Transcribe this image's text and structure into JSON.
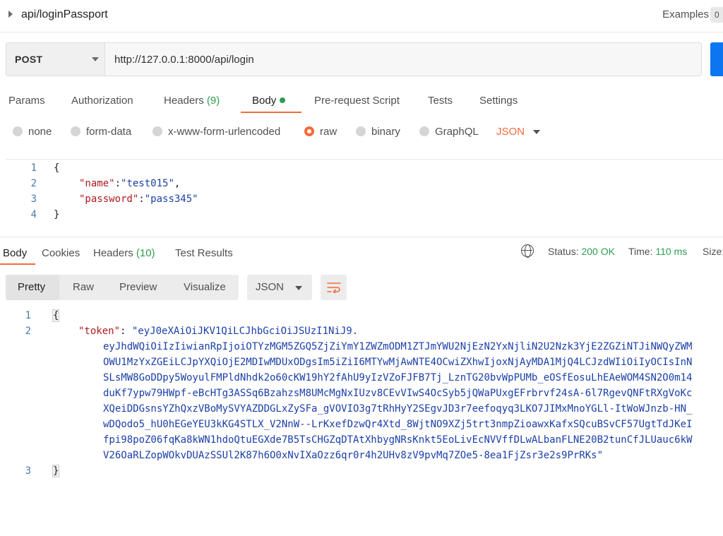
{
  "header": {
    "title": "api/loginPassport",
    "examples_label": "Examples",
    "examples_count": "0"
  },
  "request": {
    "method": "POST",
    "url": "http://127.0.0.1:8000/api/login",
    "tabs": [
      {
        "label": "Params"
      },
      {
        "label": "Authorization"
      },
      {
        "label": "Headers",
        "count": "(9)"
      },
      {
        "label": "Body"
      },
      {
        "label": "Pre-request Script"
      },
      {
        "label": "Tests"
      },
      {
        "label": "Settings"
      }
    ],
    "active_tab": "Body",
    "body_types": [
      "none",
      "form-data",
      "x-www-form-urlencoded",
      "raw",
      "binary",
      "GraphQL"
    ],
    "selected_body_type": "raw",
    "format": "JSON",
    "body_lines": [
      {
        "n": "1",
        "open": "{"
      },
      {
        "n": "2",
        "key": "\"name\"",
        "sep": ":",
        "val": "\"test015\"",
        "tail": ","
      },
      {
        "n": "3",
        "key": "\"password\"",
        "sep": ":",
        "val": "\"pass345\"",
        "tail": ""
      },
      {
        "n": "4",
        "close": "}"
      }
    ]
  },
  "response": {
    "tabs": [
      {
        "label": "Body"
      },
      {
        "label": "Cookies"
      },
      {
        "label": "Headers",
        "count": "(10)"
      },
      {
        "label": "Test Results"
      }
    ],
    "status_label": "Status:",
    "status_value": "200 OK",
    "time_label": "Time:",
    "time_value": "110 ms",
    "size_label": "Size:",
    "views": [
      "Pretty",
      "Raw",
      "Preview",
      "Visualize"
    ],
    "active_view": "Pretty",
    "format": "JSON",
    "line_numbers": [
      "1",
      "2",
      "3"
    ],
    "open_brace": "{",
    "close_brace": "}",
    "token_key": "\"token\"",
    "token_sep": ": ",
    "token_lines": [
      "\"eyJ0eXAiOiJKV1QiLCJhbGciOiJSUzI1NiJ9.",
      "eyJhdWQiOiIzIiwianRpIjoiOTYzMGM5ZGQ5ZjZiYmY1ZWZmODM1ZTJmYWU2NjEzN2YxNjliN2U2Nzk3YjE2ZGZiNTJiNWQyZWM",
      "OWU1MzYxZGEiLCJpYXQiOjE2MDIwMDUxODgsIm5iZiI6MTYwMjAwNTE4OCwiZXhwIjoxNjAyMDA1MjQ4LCJzdWIiOiIyOCIsInN",
      "SLsMW8GoDDpy5WoyulFMPldNhdk2o60cKW19hY2fAhU9yIzVZoFJFB7Tj_LznTG20bvWpPUMb_eOSfEosuLhEAeWOM4SN2O0m14",
      "duKf7ypw79HWpf-eBcHTg3ASSq6BzahzsM8UMcMgNxIUzv8CEvVIwS4OcSyb5jQWaPUxgEFrbrvf24sA-6l7RgevQNFtRXgVoKc",
      "XQeiDDGsnsYZhQxzVBoMySVYAZDDGLxZySFa_gVOVIO3g7tRhHyY2SEgvJD3r7eefoqyq3LKO7JIMxMnoYGLl-ItWoWJnzb-HN_",
      "wDQodo5_hU0hEGeYEU3kKG4STLX_V2NnW--LrKxefDzwQr4Xtd_8WjtNO9XZj5trt3nmpZioawxKafxSQcuBSvCF57UgtTdJKeI",
      "fpi98poZ06fqKa8kWN1hdoQtuEGXde7B5TsCHGZqDTAtXhbygNRsKnkt5EoLivEcNVVffDLwALbanFLNE20B2tunCfJLUauc6kW",
      "V26OaRLZopWOkvDUAzSSUl2K87h6O0xNvIXaOzz6qr0r4h2UHv8zV9pvMq7ZOe5-8ea1FjZsr3e2s9PrRKs\""
    ]
  },
  "colors": {
    "accent": "#f26b3a",
    "success": "#2f9c51",
    "send_button": "#0b76ef",
    "json_key": "#b0191f",
    "json_string": "#1b3fa8"
  }
}
